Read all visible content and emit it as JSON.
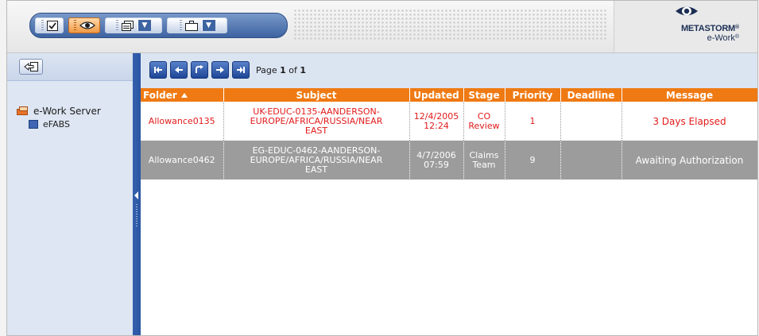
{
  "toolbar": {
    "buttons": [
      {
        "icon": "checkbox-icon",
        "active": false
      },
      {
        "icon": "eye-icon",
        "active": true
      },
      {
        "icon": "folders-icon",
        "dropdown": true
      },
      {
        "icon": "briefcase-icon",
        "dropdown": true
      }
    ]
  },
  "logo": {
    "brand": "METASTORM",
    "reg": "®",
    "product": "e-Work",
    "mark": "eye-logo-icon"
  },
  "sidebar": {
    "back_icon": "back-arrow-icon",
    "tree": [
      {
        "label": "e-Work Server",
        "icon": "server-icon"
      },
      {
        "label": "eFABS",
        "icon": "procedure-icon"
      }
    ]
  },
  "pager": {
    "buttons": [
      "first-page-icon",
      "prev-page-icon",
      "refresh-icon",
      "next-page-icon",
      "last-page-icon"
    ],
    "prefix": "Page",
    "current": "1",
    "of": "of",
    "total": "1"
  },
  "table": {
    "columns": [
      "Folder",
      "Subject",
      "Updated",
      "Stage",
      "Priority",
      "Deadline",
      "Message"
    ],
    "sort_column": "Folder",
    "rows": [
      {
        "folder": "Allowance0135",
        "subject_1": "UK-EDUC-0135-AANDERSON-",
        "subject_2": "EUROPE/AFRICA/RUSSIA/NEAR",
        "subject_3": "EAST",
        "updated_date": "12/4/2005",
        "updated_time": "12:24",
        "stage_1": "CO",
        "stage_2": "Review",
        "priority": "1",
        "deadline": "",
        "message": "3 Days Elapsed"
      },
      {
        "folder": "Allowance0462",
        "subject_1": "EG-EDUC-0462-AANDERSON-",
        "subject_2": "EUROPE/AFRICA/RUSSIA/NEAR",
        "subject_3": "EAST",
        "updated_date": "4/7/2006",
        "updated_time": "07:59",
        "stage_1": "Claims",
        "stage_2": "Team",
        "priority": "9",
        "deadline": "",
        "message": "Awaiting Authorization"
      }
    ]
  },
  "colors": {
    "header_orange": "#ef7a13",
    "row_alert_text": "#e21a1a",
    "row_selected_bg": "#9c9c9c",
    "splitter_blue": "#2a55a3"
  }
}
